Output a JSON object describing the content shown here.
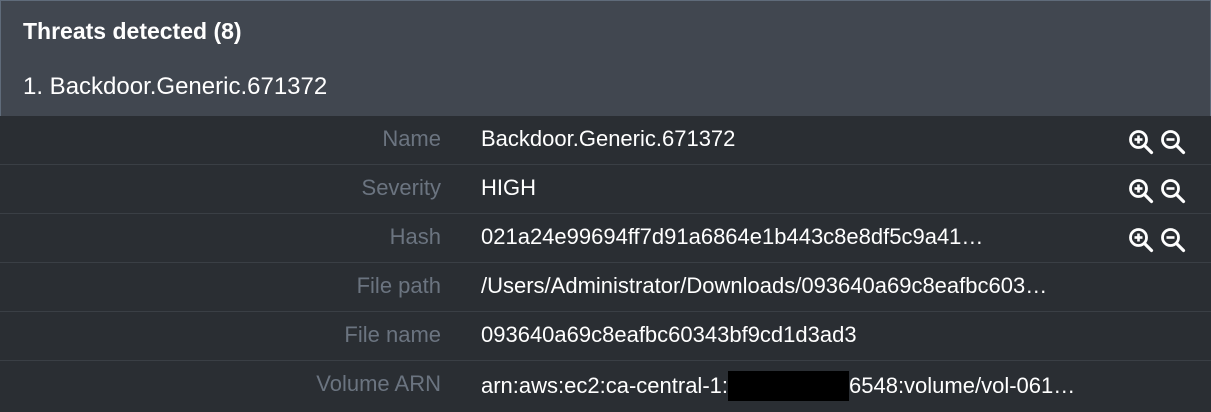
{
  "header": {
    "title": "Threats detected (8)",
    "threat_item": "1. Backdoor.Generic.671372"
  },
  "details": [
    {
      "label": "Name",
      "value": "Backdoor.Generic.671372",
      "has_filters": true
    },
    {
      "label": "Severity",
      "value": "HIGH",
      "has_filters": true
    },
    {
      "label": "Hash",
      "value": "021a24e99694ff7d91a6864e1b443c8e8df5c9a41…",
      "has_filters": true
    },
    {
      "label": "File path",
      "value": "/Users/Administrator/Downloads/093640a69c8eafbc603…",
      "has_filters": false
    },
    {
      "label": "File name",
      "value": "093640a69c8eafbc60343bf9cd1d3ad3",
      "has_filters": false
    },
    {
      "label": "Volume ARN",
      "value_prefix": "arn:aws:ec2:ca-central-1:",
      "value_suffix": "6548:volume/vol-061…",
      "has_filters": false
    }
  ],
  "icons": {
    "filter_in": "zoom-in-icon",
    "filter_out": "zoom-out-icon"
  }
}
